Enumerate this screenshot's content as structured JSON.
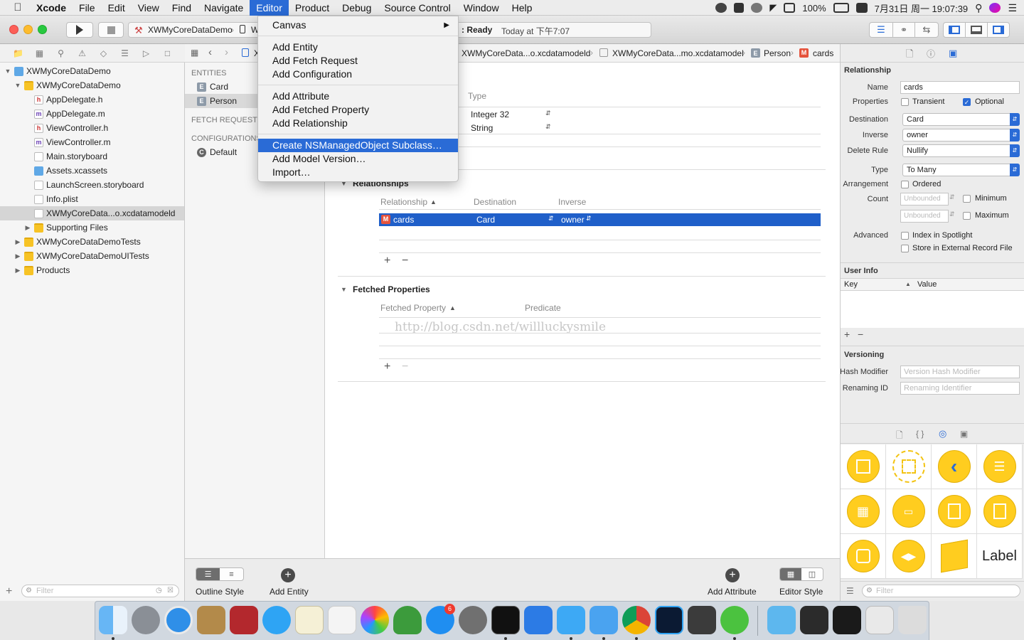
{
  "menubar": {
    "app": "Xcode",
    "items": [
      "File",
      "Edit",
      "View",
      "Find",
      "Navigate",
      "Editor",
      "Product",
      "Debug",
      "Source Control",
      "Window",
      "Help"
    ],
    "active": "Editor",
    "battery": "100%",
    "datetime": "7月31日 周一  19:07:39"
  },
  "toolbar": {
    "scheme": "XWMyCoreDataDemo",
    "device": "W",
    "status_ready": ": Ready",
    "status_time": "Today at 下午7:07"
  },
  "navigator": {
    "items": [
      {
        "label": "XWMyCoreDataDemo",
        "kind": "project",
        "depth": 0,
        "disclosure": "open"
      },
      {
        "label": "XWMyCoreDataDemo",
        "kind": "folder",
        "depth": 1,
        "disclosure": "open"
      },
      {
        "label": "AppDelegate.h",
        "kind": "h",
        "depth": 2,
        "disclosure": ""
      },
      {
        "label": "AppDelegate.m",
        "kind": "m",
        "depth": 2,
        "disclosure": ""
      },
      {
        "label": "ViewController.h",
        "kind": "h",
        "depth": 2,
        "disclosure": ""
      },
      {
        "label": "ViewController.m",
        "kind": "m",
        "depth": 2,
        "disclosure": ""
      },
      {
        "label": "Main.storyboard",
        "kind": "storyboard",
        "depth": 2,
        "disclosure": ""
      },
      {
        "label": "Assets.xcassets",
        "kind": "assets",
        "depth": 2,
        "disclosure": ""
      },
      {
        "label": "LaunchScreen.storyboard",
        "kind": "storyboard",
        "depth": 2,
        "disclosure": ""
      },
      {
        "label": "Info.plist",
        "kind": "plist",
        "depth": 2,
        "disclosure": ""
      },
      {
        "label": "XWMyCoreData...o.xcdatamodeld",
        "kind": "model",
        "depth": 2,
        "disclosure": "",
        "selected": true
      },
      {
        "label": "Supporting Files",
        "kind": "folder",
        "depth": 2,
        "disclosure": "closed"
      },
      {
        "label": "XWMyCoreDataDemoTests",
        "kind": "folder",
        "depth": 1,
        "disclosure": "closed"
      },
      {
        "label": "XWMyCoreDataDemoUITests",
        "kind": "folder",
        "depth": 1,
        "disclosure": "closed"
      },
      {
        "label": "Products",
        "kind": "folder",
        "depth": 1,
        "disclosure": "closed"
      }
    ],
    "filter_placeholder": "Filter"
  },
  "jumpbar": {
    "crumb_first": "X",
    "crumbs": [
      "XWMyCoreData...o.xcdatamodeld",
      "XWMyCoreData...mo.xcdatamodel",
      "Person",
      "cards"
    ]
  },
  "outline": {
    "entities_header": "ENTITIES",
    "entities": [
      {
        "label": "Card",
        "selected": false
      },
      {
        "label": "Person",
        "selected": true
      }
    ],
    "fetch_header": "FETCH REQUESTS",
    "config_header": "CONFIGURATIONS",
    "configs": [
      "Default"
    ]
  },
  "editor": {
    "attr_type_header": "Type",
    "attributes": [
      {
        "type": "Integer 32"
      },
      {
        "type": "String"
      }
    ],
    "relationships_title": "Relationships",
    "rel_headers": [
      "Relationship",
      "Destination",
      "Inverse"
    ],
    "relationships": [
      {
        "name": "cards",
        "destination": "Card",
        "inverse": "owner"
      }
    ],
    "fetched_title": "Fetched Properties",
    "fetched_headers": [
      "Fetched Property",
      "Predicate"
    ],
    "watermark": "http://blog.csdn.net/willluckysmile"
  },
  "bottombar": {
    "outline_style_label": "Outline Style",
    "add_entity_label": "Add Entity",
    "add_attribute_label": "Add Attribute",
    "editor_style_label": "Editor Style"
  },
  "menu": {
    "items": [
      {
        "label": "Canvas",
        "submenu": true
      },
      {
        "label": "Add Entity"
      },
      {
        "label": "Add Fetch Request"
      },
      {
        "label": "Add Configuration"
      },
      {
        "label": "Add Attribute"
      },
      {
        "label": "Add Fetched Property"
      },
      {
        "label": "Add Relationship"
      },
      {
        "label": "Create NSManagedObject Subclass…",
        "highlighted": true
      },
      {
        "label": "Add Model Version…"
      },
      {
        "label": "Import…"
      }
    ]
  },
  "inspector": {
    "section": "Relationship",
    "name_label": "Name",
    "name_value": "cards",
    "properties_label": "Properties",
    "transient_label": "Transient",
    "transient_checked": false,
    "optional_label": "Optional",
    "optional_checked": true,
    "destination_label": "Destination",
    "destination_value": "Card",
    "inverse_label": "Inverse",
    "inverse_value": "owner",
    "delete_rule_label": "Delete Rule",
    "delete_rule_value": "Nullify",
    "type_label": "Type",
    "type_value": "To Many",
    "arrangement_label": "Arrangement",
    "ordered_label": "Ordered",
    "count_label": "Count",
    "unbounded_placeholder": "Unbounded",
    "minimum_label": "Minimum",
    "maximum_label": "Maximum",
    "advanced_label": "Advanced",
    "spotlight_label": "Index in Spotlight",
    "external_label": "Store in External Record File",
    "user_info_title": "User Info",
    "key_header": "Key",
    "value_header": "Value",
    "versioning_title": "Versioning",
    "hash_label": "Hash Modifier",
    "hash_placeholder": "Version Hash Modifier",
    "renaming_label": "Renaming ID",
    "renaming_placeholder": "Renaming Identifier",
    "library_label_item": "Label",
    "filter_placeholder": "Filter"
  },
  "dock": {
    "badge": "6"
  },
  "colors": {
    "accent": "#2a6bd6",
    "library_yellow": "#ffcd1f",
    "selection_row": "#1f5fc9"
  }
}
